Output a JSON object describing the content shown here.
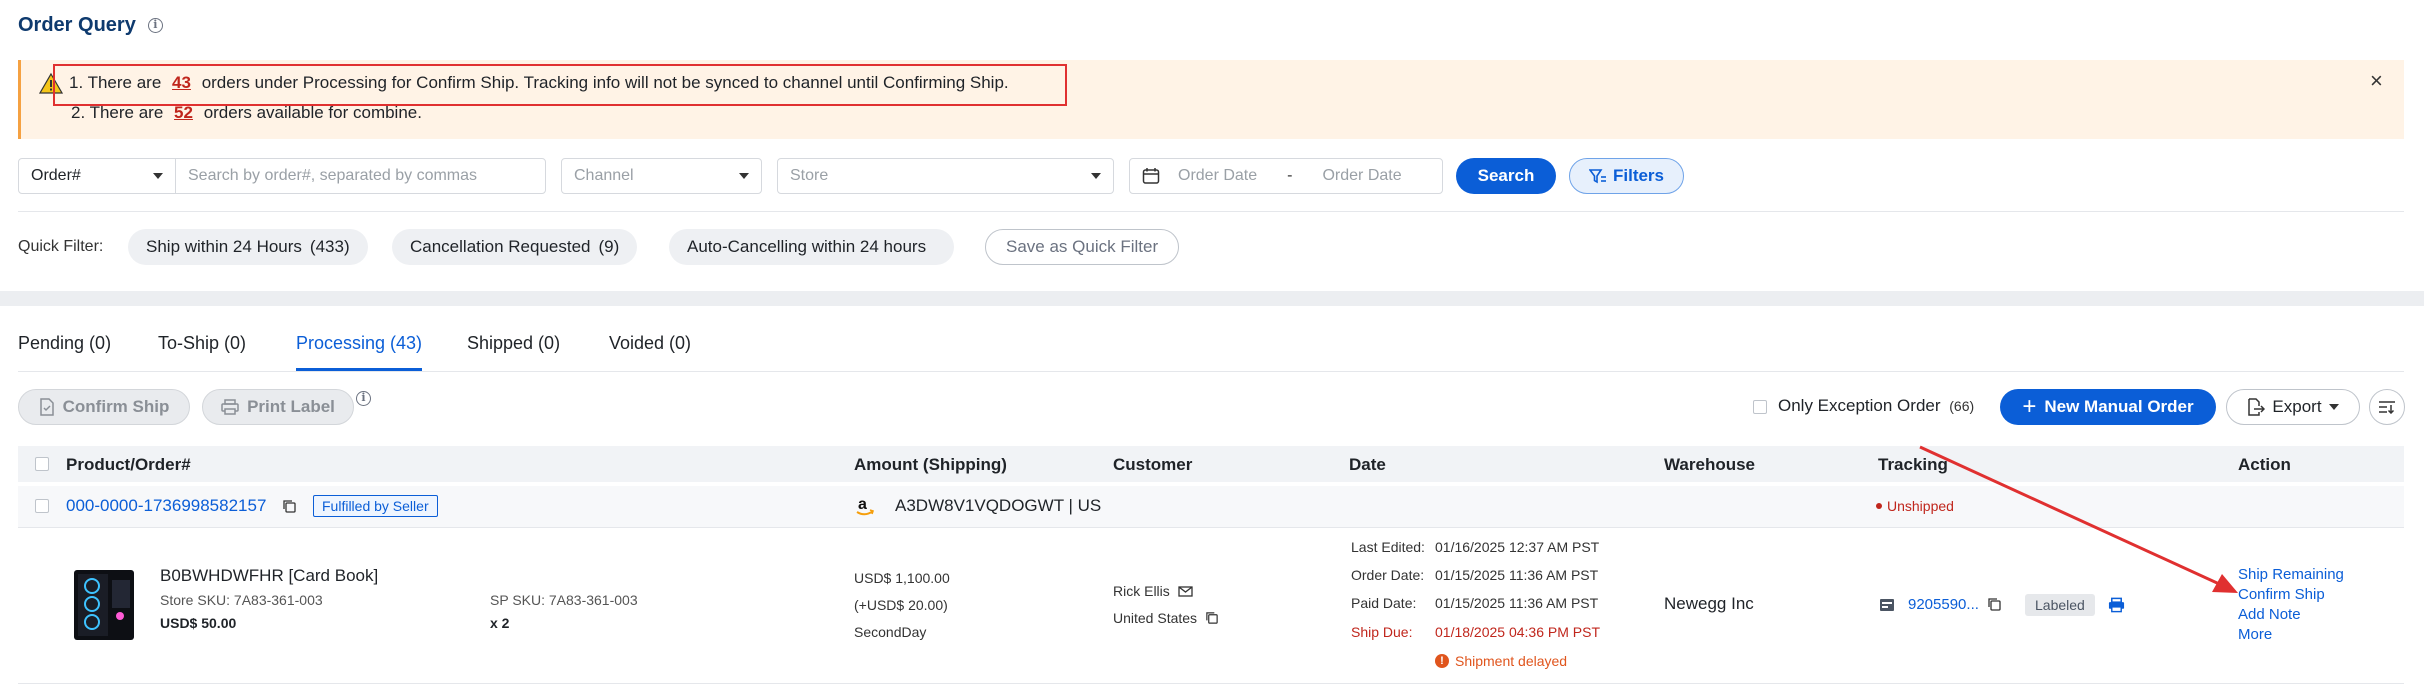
{
  "page": {
    "title": "Order Query"
  },
  "banner": {
    "line1_pre": "1. There are",
    "line1_num": "43",
    "line1_post": "orders under Processing for Confirm Ship. Tracking info will not be synced to channel until Confirming Ship.",
    "line2_pre": "2. There are",
    "line2_num": "52",
    "line2_post": "orders available for combine.",
    "close": "×"
  },
  "search": {
    "type_select": "Order#",
    "placeholder": "Search by order#, separated by commas",
    "channel_placeholder": "Channel",
    "store_placeholder": "Store",
    "date_from_placeholder": "Order Date",
    "date_sep": "-",
    "date_to_placeholder": "Order Date",
    "search_button": "Search",
    "filters_button": "Filters"
  },
  "quick_filter": {
    "label": "Quick Filter:",
    "chips": [
      {
        "label": "Ship within 24 Hours",
        "count": "(433)"
      },
      {
        "label": "Cancellation Requested",
        "count": "(9)"
      },
      {
        "label": "Auto-Cancelling within 24 hours",
        "count": ""
      }
    ],
    "save_button": "Save as Quick Filter"
  },
  "tabs": [
    {
      "label": "Pending (0)"
    },
    {
      "label": "To-Ship (0)"
    },
    {
      "label": "Processing (43)",
      "active": true
    },
    {
      "label": "Shipped (0)"
    },
    {
      "label": "Voided (0)"
    }
  ],
  "toolbar": {
    "confirm_ship": "Confirm Ship",
    "print_label": "Print Label",
    "only_exception_label": "Only Exception Order",
    "only_exception_count": "(66)",
    "new_manual_order": "New Manual Order",
    "export": "Export"
  },
  "table": {
    "headers": {
      "product": "Product/Order#",
      "amount": "Amount (Shipping)",
      "customer": "Customer",
      "date": "Date",
      "warehouse": "Warehouse",
      "tracking": "Tracking",
      "action": "Action"
    },
    "order": {
      "order_number": "000-0000-1736998582157",
      "fulfilled_badge": "Fulfilled by Seller",
      "channel_store": "A3DW8V1VQDOGWT | US",
      "status": "Unshipped",
      "product_title": "B0BWHDWFHR [Card Book]",
      "store_sku": "Store SKU: 7A83-361-003",
      "price": "USD$ 50.00",
      "sp_sku": "SP SKU: 7A83-361-003",
      "qty": "x 2",
      "amount": "USD$ 1,100.00",
      "shipping": "(+USD$ 20.00)",
      "ship_method": "SecondDay",
      "customer_name": "Rick Ellis",
      "customer_country": "United States",
      "last_edited_label": "Last Edited:",
      "last_edited": "01/16/2025 12:37 AM PST",
      "order_date_label": "Order Date:",
      "order_date": "01/15/2025 11:36 AM PST",
      "paid_date_label": "Paid Date:",
      "paid_date": "01/15/2025 11:36 AM PST",
      "ship_due_label": "Ship Due:",
      "ship_due": "01/18/2025 04:36 PM PST",
      "shipment_delayed": "Shipment delayed",
      "warehouse": "Newegg Inc",
      "tracking_number": "9205590...",
      "tracking_status": "Labeled",
      "actions": [
        "Ship Remaining",
        "Confirm Ship",
        "Add Note",
        "More"
      ]
    }
  },
  "colors": {
    "primary": "#0b5ed7",
    "title": "#0e3a6e",
    "banner_bg": "#fff3e6",
    "alert_red": "#c0261c",
    "annotation_red": "#e03030"
  }
}
